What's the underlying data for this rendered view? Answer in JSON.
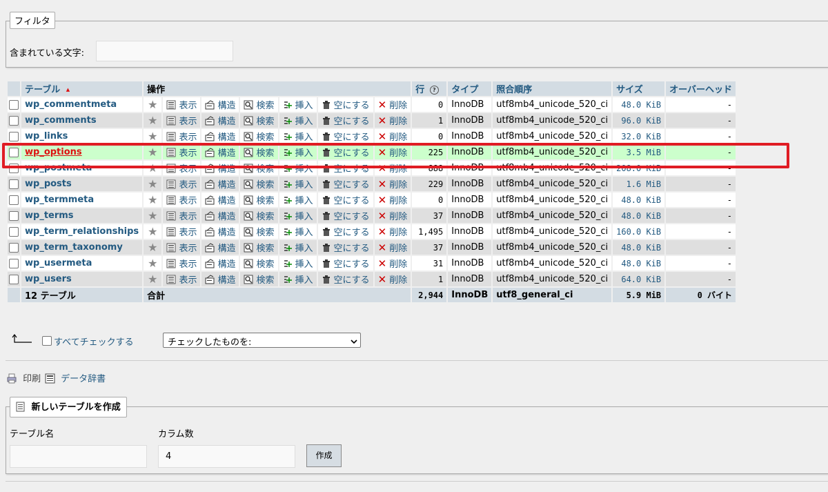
{
  "filter": {
    "legend": "フィルタ",
    "label": "含まれている文字:",
    "value": ""
  },
  "table": {
    "headers": {
      "table": "テーブル",
      "sort_arrow": "▲",
      "actions": "操作",
      "rows": "行",
      "help": "?",
      "type": "タイプ",
      "collation": "照合順序",
      "size": "サイズ",
      "overhead": "オーバーヘッド"
    },
    "action_labels": {
      "browse": "表示",
      "structure": "構造",
      "search": "検索",
      "insert": "挿入",
      "empty": "空にする",
      "drop": "削除"
    },
    "rows": [
      {
        "name": "wp_commentmeta",
        "rows": "0",
        "type": "InnoDB",
        "collation": "utf8mb4_unicode_520_ci",
        "size": "48.0 KiB",
        "overhead": "-"
      },
      {
        "name": "wp_comments",
        "rows": "1",
        "type": "InnoDB",
        "collation": "utf8mb4_unicode_520_ci",
        "size": "96.0 KiB",
        "overhead": "-"
      },
      {
        "name": "wp_links",
        "rows": "0",
        "type": "InnoDB",
        "collation": "utf8mb4_unicode_520_ci",
        "size": "32.0 KiB",
        "overhead": "-"
      },
      {
        "name": "wp_options",
        "rows": "225",
        "type": "InnoDB",
        "collation": "utf8mb4_unicode_520_ci",
        "size": "3.5 MiB",
        "overhead": "-"
      },
      {
        "name": "wp_postmeta",
        "rows": "888",
        "type": "InnoDB",
        "collation": "utf8mb4_unicode_520_ci",
        "size": "208.0 KiB",
        "overhead": "-"
      },
      {
        "name": "wp_posts",
        "rows": "229",
        "type": "InnoDB",
        "collation": "utf8mb4_unicode_520_ci",
        "size": "1.6 MiB",
        "overhead": "-"
      },
      {
        "name": "wp_termmeta",
        "rows": "0",
        "type": "InnoDB",
        "collation": "utf8mb4_unicode_520_ci",
        "size": "48.0 KiB",
        "overhead": "-"
      },
      {
        "name": "wp_terms",
        "rows": "37",
        "type": "InnoDB",
        "collation": "utf8mb4_unicode_520_ci",
        "size": "48.0 KiB",
        "overhead": "-"
      },
      {
        "name": "wp_term_relationships",
        "rows": "1,495",
        "type": "InnoDB",
        "collation": "utf8mb4_unicode_520_ci",
        "size": "160.0 KiB",
        "overhead": "-"
      },
      {
        "name": "wp_term_taxonomy",
        "rows": "37",
        "type": "InnoDB",
        "collation": "utf8mb4_unicode_520_ci",
        "size": "48.0 KiB",
        "overhead": "-"
      },
      {
        "name": "wp_usermeta",
        "rows": "31",
        "type": "InnoDB",
        "collation": "utf8mb4_unicode_520_ci",
        "size": "48.0 KiB",
        "overhead": "-"
      },
      {
        "name": "wp_users",
        "rows": "1",
        "type": "InnoDB",
        "collation": "utf8mb4_unicode_520_ci",
        "size": "64.0 KiB",
        "overhead": "-"
      }
    ],
    "highlighted_row": "wp_options",
    "footer": {
      "count": "12 テーブル",
      "total_label": "合計",
      "rows": "2,944",
      "type": "InnoDB",
      "collation": "utf8_general_ci",
      "size": "5.9 MiB",
      "overhead": "0 バイト"
    }
  },
  "bulk": {
    "check_all": "すべてチェックする",
    "with_selected": "チェックしたものを:"
  },
  "links": {
    "print": "印刷",
    "data_dict": "データ辞書"
  },
  "create": {
    "legend": "新しいテーブルを作成",
    "name_label": "テーブル名",
    "name_value": "",
    "cols_label": "カラム数",
    "cols_value": "4",
    "submit": "作成"
  },
  "colors": {
    "link": "#235a81",
    "header_bg": "#d3dce3",
    "highlight_bg": "#ccffcc",
    "highlight_border": "#e01c24"
  }
}
